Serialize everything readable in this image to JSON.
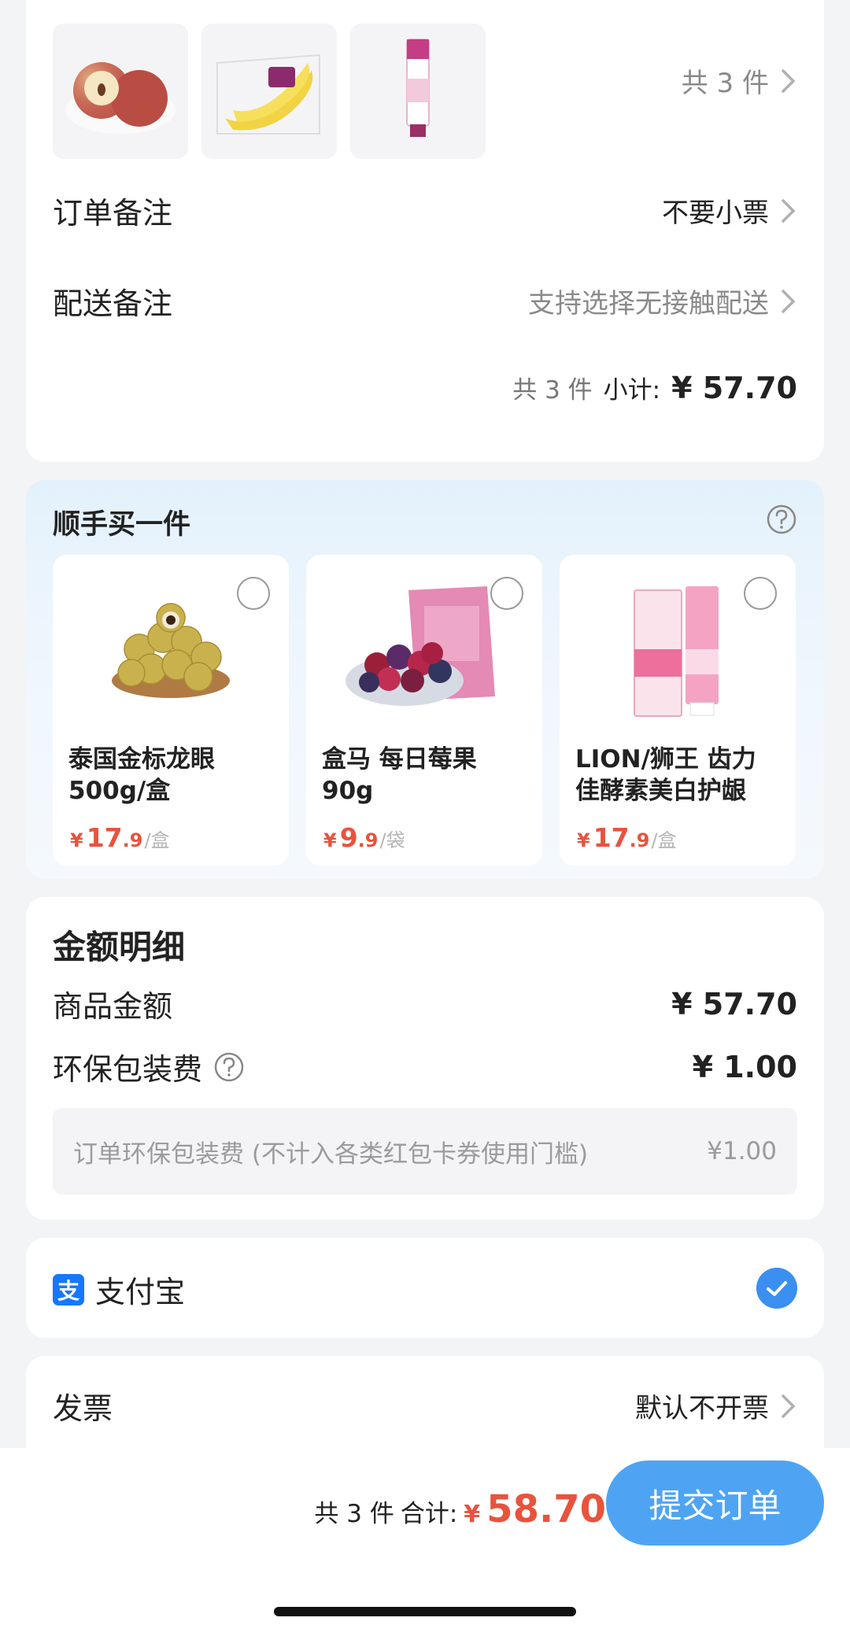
{
  "order": {
    "items": [
      {
        "name": "apple",
        "icon": "apple-image"
      },
      {
        "name": "banana",
        "icon": "banana-image"
      },
      {
        "name": "toothpaste",
        "icon": "toothpaste-image"
      }
    ],
    "item_count_text": "共 3 件",
    "order_note_label": "订单备注",
    "order_note_value": "不要小票",
    "delivery_note_label": "配送备注",
    "delivery_note_value": "支持选择无接触配送",
    "subtotal_count": "共 3 件",
    "subtotal_label": "小计:",
    "subtotal_amount": "¥ 57.70"
  },
  "addon": {
    "title": "顺手买一件",
    "items": [
      {
        "name": "泰国金标龙眼\n500g/盒",
        "currency": "¥",
        "price_int": "17",
        "price_dec": ".9",
        "unit": "/盒",
        "selected": false
      },
      {
        "name": "盒马 每日莓果\n90g",
        "currency": "¥",
        "price_int": "9",
        "price_dec": ".9",
        "unit": "/袋",
        "selected": false
      },
      {
        "name": "LION/狮王 齿力\n佳酵素美白护龈",
        "currency": "¥",
        "price_int": "17",
        "price_dec": ".9",
        "unit": "/盒",
        "selected": false
      }
    ]
  },
  "amount": {
    "title": "金额明细",
    "goods_label": "商品金额",
    "goods_value": "¥ 57.70",
    "packaging_label": "环保包装费",
    "packaging_value": "¥ 1.00",
    "note_text": "订单环保包装费 (不计入各类红包卡券使用门槛)",
    "note_value": "¥1.00"
  },
  "payment": {
    "method": "支付宝",
    "logo_char": "支",
    "selected": true,
    "brand_color": "#1677ff"
  },
  "invoice": {
    "label": "发票",
    "value": "默认不开票"
  },
  "footer": {
    "count": "共 3 件",
    "total_label": "合计:",
    "currency": "¥",
    "total_value": "58.70",
    "submit_label": "提交订单"
  },
  "colors": {
    "accent_blue": "#4ea4f3",
    "price_red": "#e8533d"
  }
}
